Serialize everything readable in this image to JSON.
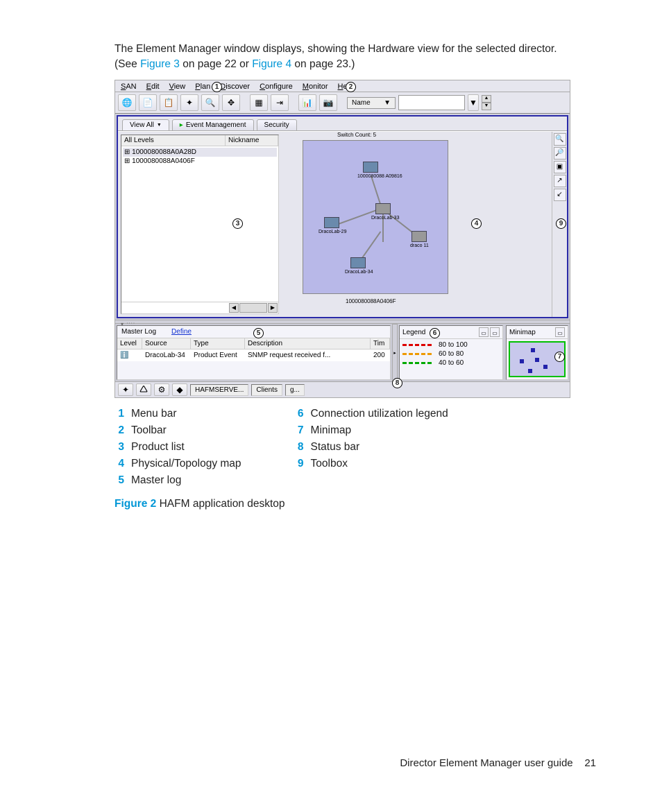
{
  "intro": {
    "line1": "The Element Manager window displays, showing the Hardware view for the selected director.",
    "line2a": "(See ",
    "xref1": "Figure 3",
    "line2b": " on page 22 or ",
    "xref2": "Figure 4",
    "line2c": " on page 23.)"
  },
  "menubar": {
    "san": "SAN",
    "edit": "Edit",
    "view": "View",
    "plan": "Plan",
    "discover": "Discover",
    "configure": "Configure",
    "monitor": "Monitor",
    "help": "Help"
  },
  "toolbar": {
    "name_label": "Name"
  },
  "tabs": {
    "viewall": "View All",
    "eventmgmt": "Event Management",
    "security": "Security"
  },
  "tree": {
    "col_levels": "All Levels",
    "col_nickname": "Nickname",
    "row1": "1000080088A0A28D",
    "row2": "1000080088A0406F"
  },
  "map": {
    "switch_count": "Switch Count: 5",
    "n1": "1000080088 A09816",
    "n2": "DracoLab-29",
    "n3": "DracoLab-33",
    "n4": "draco 11",
    "n5": "DracoLab-34",
    "footer_id": "1000080088A0406F"
  },
  "masterlog": {
    "title": "Master Log",
    "define": "Define",
    "cols": {
      "level": "Level",
      "source": "Source",
      "type": "Type",
      "description": "Description",
      "tim": "Tim"
    },
    "row": {
      "source": "DracoLab-34",
      "type": "Product Event",
      "desc": "SNMP request received f...",
      "tim": "200"
    }
  },
  "legend": {
    "title": "Legend",
    "r1": "80 to 100",
    "r2": "60 to 80",
    "r3": "40 to 60"
  },
  "minimap": {
    "title": "Minimap"
  },
  "statusbar": {
    "server": "HAFMSERVE...",
    "clients": "Clients",
    "g": "g..."
  },
  "callouts": {
    "c1": "1",
    "c2": "2",
    "c3": "3",
    "c4": "4",
    "c5": "5",
    "c6": "6",
    "c7": "7",
    "c8": "8",
    "c9": "9"
  },
  "legend_list": {
    "l1": "Menu bar",
    "l2": "Toolbar",
    "l3": "Product list",
    "l4": "Physical/Topology map",
    "l5": "Master log",
    "l6": "Connection utilization legend",
    "l7": "Minimap",
    "l8": "Status bar",
    "l9": "Toolbox"
  },
  "figure": {
    "label": "Figure 2",
    "caption": " HAFM application desktop"
  },
  "footer": {
    "title": "Director Element Manager user guide",
    "page": "21"
  }
}
